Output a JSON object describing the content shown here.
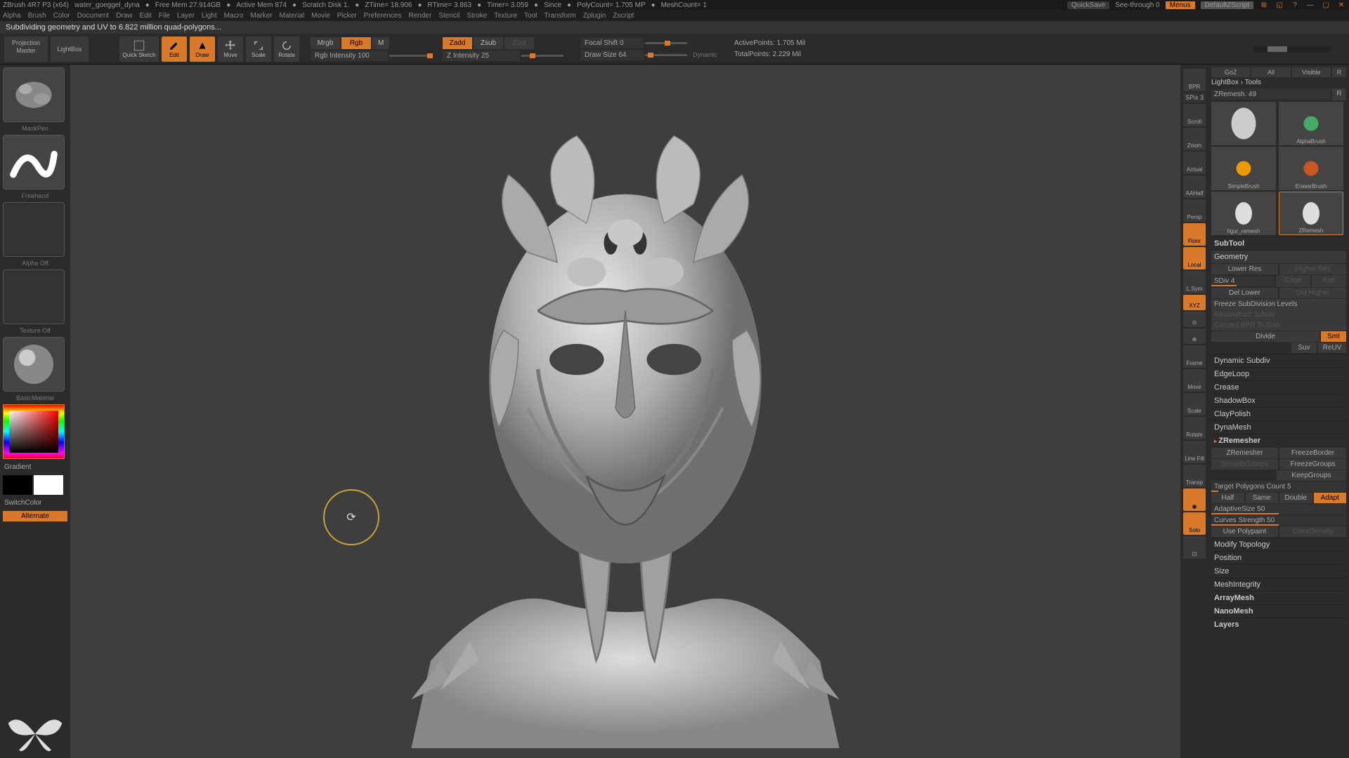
{
  "titlebar": {
    "app": "ZBrush 4R7 P3 (x64)",
    "filename": "water_goeggel_dyna",
    "freemem": "Free Mem 27.914GB",
    "activemem": "Active Mem 874",
    "scratch": "Scratch Disk 1.",
    "ztime": "ZTime= 18.906",
    "rtime": "RTime= 3.863",
    "timer": "Timer= 3.059",
    "since": "Since",
    "polycount": "PolyCount= 1.705 MP",
    "meshcount": "MeshCount= 1",
    "quicksave": "QuickSave",
    "seethrough": "See-through 0",
    "menus": "Menus",
    "zscript": "DefaultZScript"
  },
  "menubar": [
    "Alpha",
    "Brush",
    "Color",
    "Document",
    "Draw",
    "Edit",
    "File",
    "Layer",
    "Light",
    "Macro",
    "Marker",
    "Material",
    "Movie",
    "Picker",
    "Preferences",
    "Render",
    "Stencil",
    "Stroke",
    "Texture",
    "Tool",
    "Transform",
    "Zplugin",
    "Zscript"
  ],
  "status_message": "Subdividing geometry and UV to 6.822 million quad-polygons...",
  "toolbar": {
    "projection": "Projection\nMaster",
    "lightbox": "LightBox",
    "quicksketch": "Quick\nSketch",
    "edit": "Edit",
    "draw": "Draw",
    "move": "Move",
    "scale": "Scale",
    "rotate": "Rotate",
    "mrgb": "Mrgb",
    "rgb": "Rgb",
    "m": "M",
    "zadd": "Zadd",
    "zsub": "Zsub",
    "zcut": "Zcut",
    "rgb_intensity": "Rgb Intensity 100",
    "z_intensity": "Z Intensity 25",
    "focal_shift": "Focal Shift 0",
    "draw_size": "Draw Size 64",
    "dynamic": "Dynamic",
    "activepoints": "ActivePoints: 1.705 Mil",
    "totalpoints": "TotalPoints: 2.229 Mil"
  },
  "left": {
    "maskpen": "MaskPen",
    "freehand": "Freehand",
    "alpha_off": "Alpha Off",
    "texture_off": "Texture Off",
    "material": "BasicMaterial",
    "gradient": "Gradient",
    "switchcolor": "SwitchColor",
    "alternate": "Alternate"
  },
  "rightnav": {
    "spix": "SPix 3",
    "items": [
      "BPR",
      "Scroll",
      "Zoom",
      "Actual",
      "AAHalf",
      "Persp",
      "Floor",
      "Local",
      "L.Sym",
      "XYZ",
      "",
      "",
      "Frame",
      "Move",
      "Scale",
      "Rotate",
      "Line Fill",
      "",
      "Transp",
      "",
      "Solo",
      ""
    ]
  },
  "rightpanel": {
    "header": {
      "goz": "GoZ",
      "all": "All",
      "visible": "Visible",
      "r": "R"
    },
    "breadcrumb": "LightBox › Tools",
    "zremesh": "ZRemesh. 49",
    "r2": "R",
    "tools": [
      {
        "name": ""
      },
      {
        "name": "AlphaBrush"
      },
      {
        "name": "SimpleBrush"
      },
      {
        "name": "EraserBrush"
      },
      {
        "name": "figur_remesh"
      },
      {
        "name": "ZRemesh"
      }
    ],
    "subtool": "SubTool",
    "geometry": "Geometry",
    "lower_res": "Lower Res",
    "higher_res": "Higher Res",
    "sdiv": "SDiv 4",
    "cage": "Cage",
    "rstr": "Rstr",
    "del_lower": "Del Lower",
    "del_higher": "Del Higher",
    "freeze_sub": "Freeze SubDivision Levels",
    "reconstruct": "Reconstruct Subdiv",
    "convert_bpr": "Convert BPR To Geo",
    "divide": "Divide",
    "smt": "Smt",
    "suv": "Suv",
    "reuv": "ReUV",
    "dynamic_subdiv": "Dynamic Subdiv",
    "edgeloop": "EdgeLoop",
    "crease": "Crease",
    "shadowbox": "ShadowBox",
    "claypolish": "ClayPolish",
    "dynamesh": "DynaMesh",
    "zremesher_h": "ZRemesher",
    "zremesher": "ZRemesher",
    "freezeborder": "FreezeBorder",
    "smoothgroups": "SmoothGroups",
    "freezegroups": "FreezeGroups",
    "keepgroups": "KeepGroups",
    "target_poly": "Target Polygons Count 5",
    "half": "Half",
    "same": "Same",
    "double": "Double",
    "adapt": "Adapt",
    "adaptivesize": "AdaptiveSize 50",
    "curves_strength": "Curves Strength 50",
    "use_polypaint": "Use Polypaint",
    "colordensity": "ColorDensity",
    "modify_topo": "Modify Topology",
    "position": "Position",
    "size": "Size",
    "meshintegrity": "MeshIntegrity",
    "arraymesh": "ArrayMesh",
    "nanomesh": "NanoMesh",
    "layers": "Layers"
  }
}
